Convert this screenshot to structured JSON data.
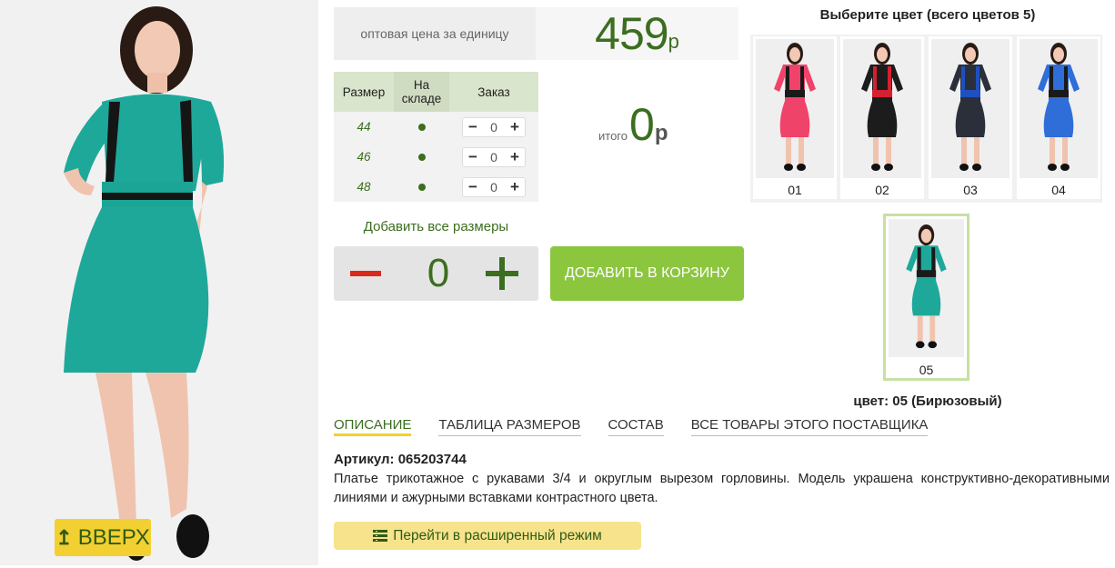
{
  "price": {
    "label": "оптовая цена за единицу",
    "value": "459",
    "currency": "р"
  },
  "size_table": {
    "headers": [
      "Размер",
      "На складе",
      "Заказ"
    ],
    "rows": [
      {
        "size": "44",
        "in_stock": true,
        "qty": "0"
      },
      {
        "size": "46",
        "in_stock": true,
        "qty": "0"
      },
      {
        "size": "48",
        "in_stock": true,
        "qty": "0"
      }
    ],
    "minus": "−",
    "plus": "+"
  },
  "total": {
    "label": "итого",
    "value": "0",
    "currency": "р"
  },
  "add_all_sizes": "Добавить все размеры",
  "quantity": {
    "value": "0"
  },
  "add_to_cart": "ДОБАВИТЬ В КОРЗИНУ",
  "colors": {
    "title": "Выберите цвет (всего цветов 5)",
    "swatches": [
      {
        "num": "01",
        "color": "#f0436a",
        "trim": "#1a1a1a"
      },
      {
        "num": "02",
        "color": "#1c1c1c",
        "trim": "#d42030"
      },
      {
        "num": "03",
        "color": "#2a2f3a",
        "trim": "#1f50c0"
      },
      {
        "num": "04",
        "color": "#2f6dd8",
        "trim": "#1a1a1a"
      }
    ],
    "selected": {
      "num": "05",
      "color": "#1ea89a",
      "trim": "#1a1a1a"
    },
    "caption": "цвет: 05 (Бирюзовый)"
  },
  "tabs": [
    "ОПИСАНИЕ",
    "ТАБЛИЦА РАЗМЕРОВ",
    "СОСТАВ",
    "ВСЕ ТОВАРЫ ЭТОГО ПОСТАВЩИКА"
  ],
  "article": "Артикул: 065203744",
  "description": "Платье трикотажное с рукавами 3/4 и округлым вырезом горловины. Модель украшена конструктивно-декоративными линиями и ажурными вставками контрастного цвета.",
  "extended_mode": "Перейти в расширенный режим",
  "up_button": "ВВЕРХ",
  "theme": {
    "accent_green": "#3b6e1f",
    "button_green": "#8cc63f",
    "yellow": "#f2d031",
    "minus_red": "#d92a1c",
    "dress_main": "#1ea89a"
  }
}
